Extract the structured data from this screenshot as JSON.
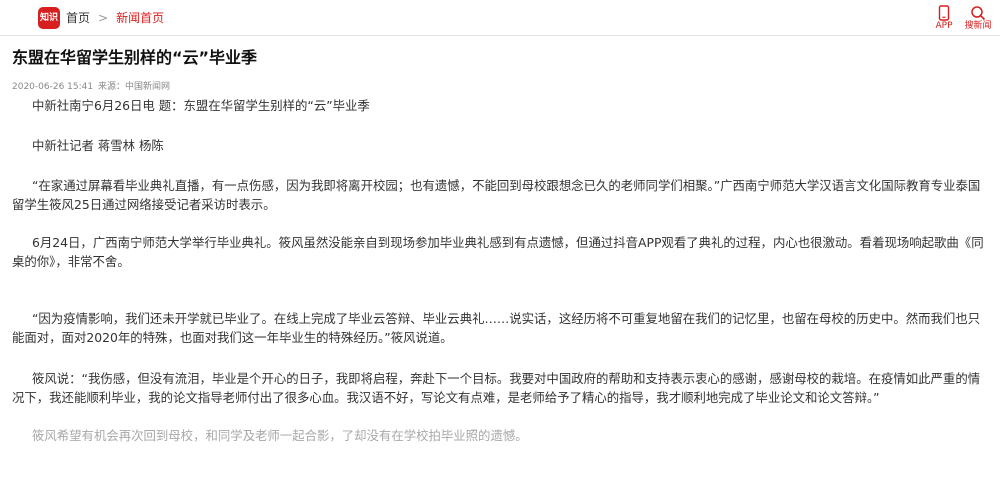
{
  "header": {
    "logo_text": "知识",
    "breadcrumb_home": "首页",
    "breadcrumb_separator": ">",
    "breadcrumb_current": "新闻首页",
    "app_label": "APP",
    "search_label": "搜新闻",
    "icons": {
      "app": "phone-icon",
      "search": "search-icon"
    },
    "accent_color": "#d71f1f"
  },
  "article": {
    "title": "东盟在华留学生别样的“云”毕业季",
    "datetime": "2020-06-26 15:41",
    "source": "来源：中国新闻网",
    "paragraphs": [
      "中新社南宁6月26日电 题：东盟在华留学生别样的“云”毕业季",
      "中新社记者 蒋雪林 杨陈",
      "“在家通过屏幕看毕业典礼直播，有一点伤感，因为我即将离开校园；也有遗憾，不能回到母校跟想念已久的老师同学们相聚。”广西南宁师范大学汉语言文化国际教育专业泰国留学生筱风25日通过网络接受记者采访时表示。",
      "6月24日，广西南宁师范大学举行毕业典礼。筱风虽然没能亲自到现场参加毕业典礼感到有点遗憾，但通过抖音APP观看了典礼的过程，内心也很激动。看着现场响起歌曲《同桌的你》，非常不舍。",
      "“因为疫情影响，我们还未开学就已毕业了。在线上完成了毕业云答辩、毕业云典礼……说实话，这经历将不可重复地留在我们的记忆里，也留在母校的历史中。然而我们也只能面对，面对2020年的特殊，也面对我们这一年毕业生的特殊经历。”筱风说道。",
      "筱风说：“我伤感，但没有流泪，毕业是个开心的日子，我即将启程，奔赴下一个目标。我要对中国政府的帮助和支持表示衷心的感谢，感谢母校的栽培。在疫情如此严重的情况下，我还能顺利毕业，我的论文指导老师付出了很多心血。我汉语不好，写论文有点难，是老师给予了精心的指导，我才顺利地完成了毕业论文和论文答辩。”",
      "筱风希望有机会再次回到母校，和同学及老师一起合影，了却没有在学校拍毕业照的遗憾。"
    ]
  }
}
